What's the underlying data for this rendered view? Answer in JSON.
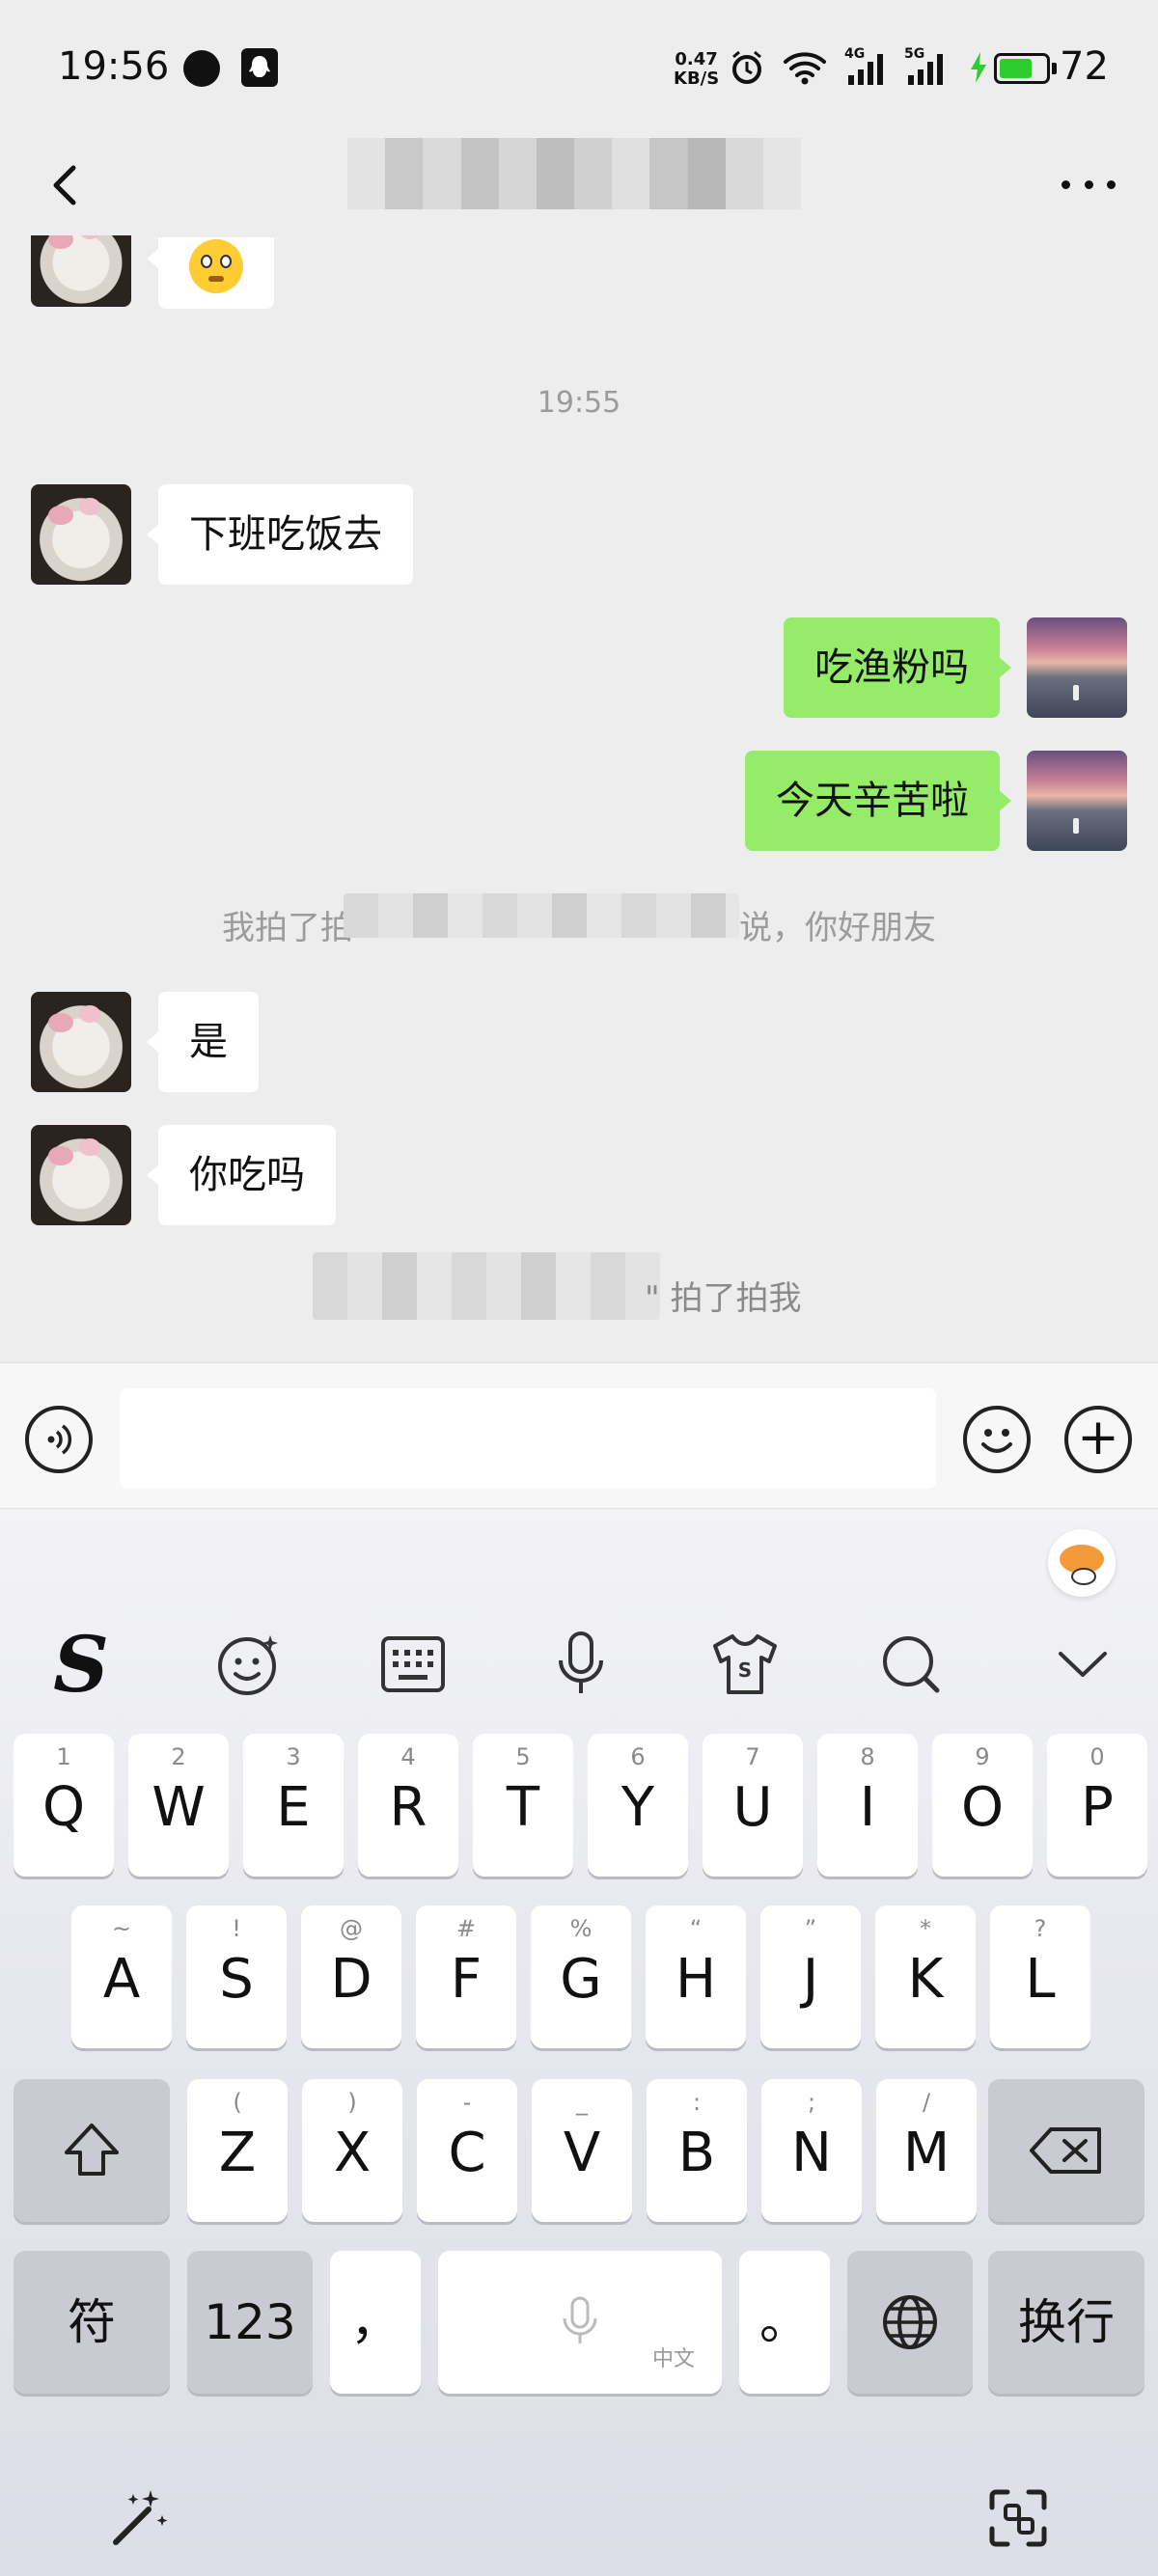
{
  "status_bar": {
    "time": "19:56",
    "net_speed_value": "0.47",
    "net_speed_unit": "KB/S",
    "signal1_label": "4G",
    "signal2_label": "5G",
    "battery_level": "72",
    "battery_color": "#2ecc2e"
  },
  "nav": {
    "back_icon": "chevron-left-icon",
    "more_icon": "more-dots-icon"
  },
  "chat": {
    "timestamp": "19:55",
    "messages": [
      {
        "side": "left",
        "text": "下班吃饭去"
      },
      {
        "side": "right",
        "text": "吃渔粉吗"
      },
      {
        "side": "right",
        "text": "今天辛苦啦"
      },
      {
        "side": "left",
        "text": "是"
      },
      {
        "side": "left",
        "text": "你吃吗"
      }
    ],
    "system1": {
      "prefix": "我拍了拍",
      "suffix": "说，你好朋友"
    },
    "system2": {
      "suffix": "\" 拍了拍我"
    }
  },
  "input_bar": {
    "voice_icon": "voice-icon",
    "emoji_icon": "emoji-icon",
    "plus_icon": "plus-icon",
    "plus_label": "+"
  },
  "keyboard": {
    "toolbar_logo": "S",
    "row1": [
      {
        "num": "1",
        "letter": "Q"
      },
      {
        "num": "2",
        "letter": "W"
      },
      {
        "num": "3",
        "letter": "E"
      },
      {
        "num": "4",
        "letter": "R"
      },
      {
        "num": "5",
        "letter": "T"
      },
      {
        "num": "6",
        "letter": "Y"
      },
      {
        "num": "7",
        "letter": "U"
      },
      {
        "num": "8",
        "letter": "I"
      },
      {
        "num": "9",
        "letter": "O"
      },
      {
        "num": "0",
        "letter": "P"
      }
    ],
    "row2": [
      {
        "sym": "~",
        "letter": "A"
      },
      {
        "sym": "!",
        "letter": "S"
      },
      {
        "sym": "@",
        "letter": "D"
      },
      {
        "sym": "#",
        "letter": "F"
      },
      {
        "sym": "%",
        "letter": "G"
      },
      {
        "sym": "“",
        "letter": "H"
      },
      {
        "sym": "”",
        "letter": "J"
      },
      {
        "sym": "*",
        "letter": "K"
      },
      {
        "sym": "?",
        "letter": "L"
      }
    ],
    "row3": [
      {
        "sym": "(",
        "letter": "Z"
      },
      {
        "sym": ")",
        "letter": "X"
      },
      {
        "sym": "-",
        "letter": "C"
      },
      {
        "sym": "_",
        "letter": "V"
      },
      {
        "sym": ":",
        "letter": "B"
      },
      {
        "sym": ";",
        "letter": "N"
      },
      {
        "sym": "/",
        "letter": "M"
      }
    ],
    "symbols_label": "符",
    "numbers_label": "123",
    "comma_label": "，",
    "space_sub_label": "中文",
    "period_label": "。",
    "enter_label": "换行"
  }
}
